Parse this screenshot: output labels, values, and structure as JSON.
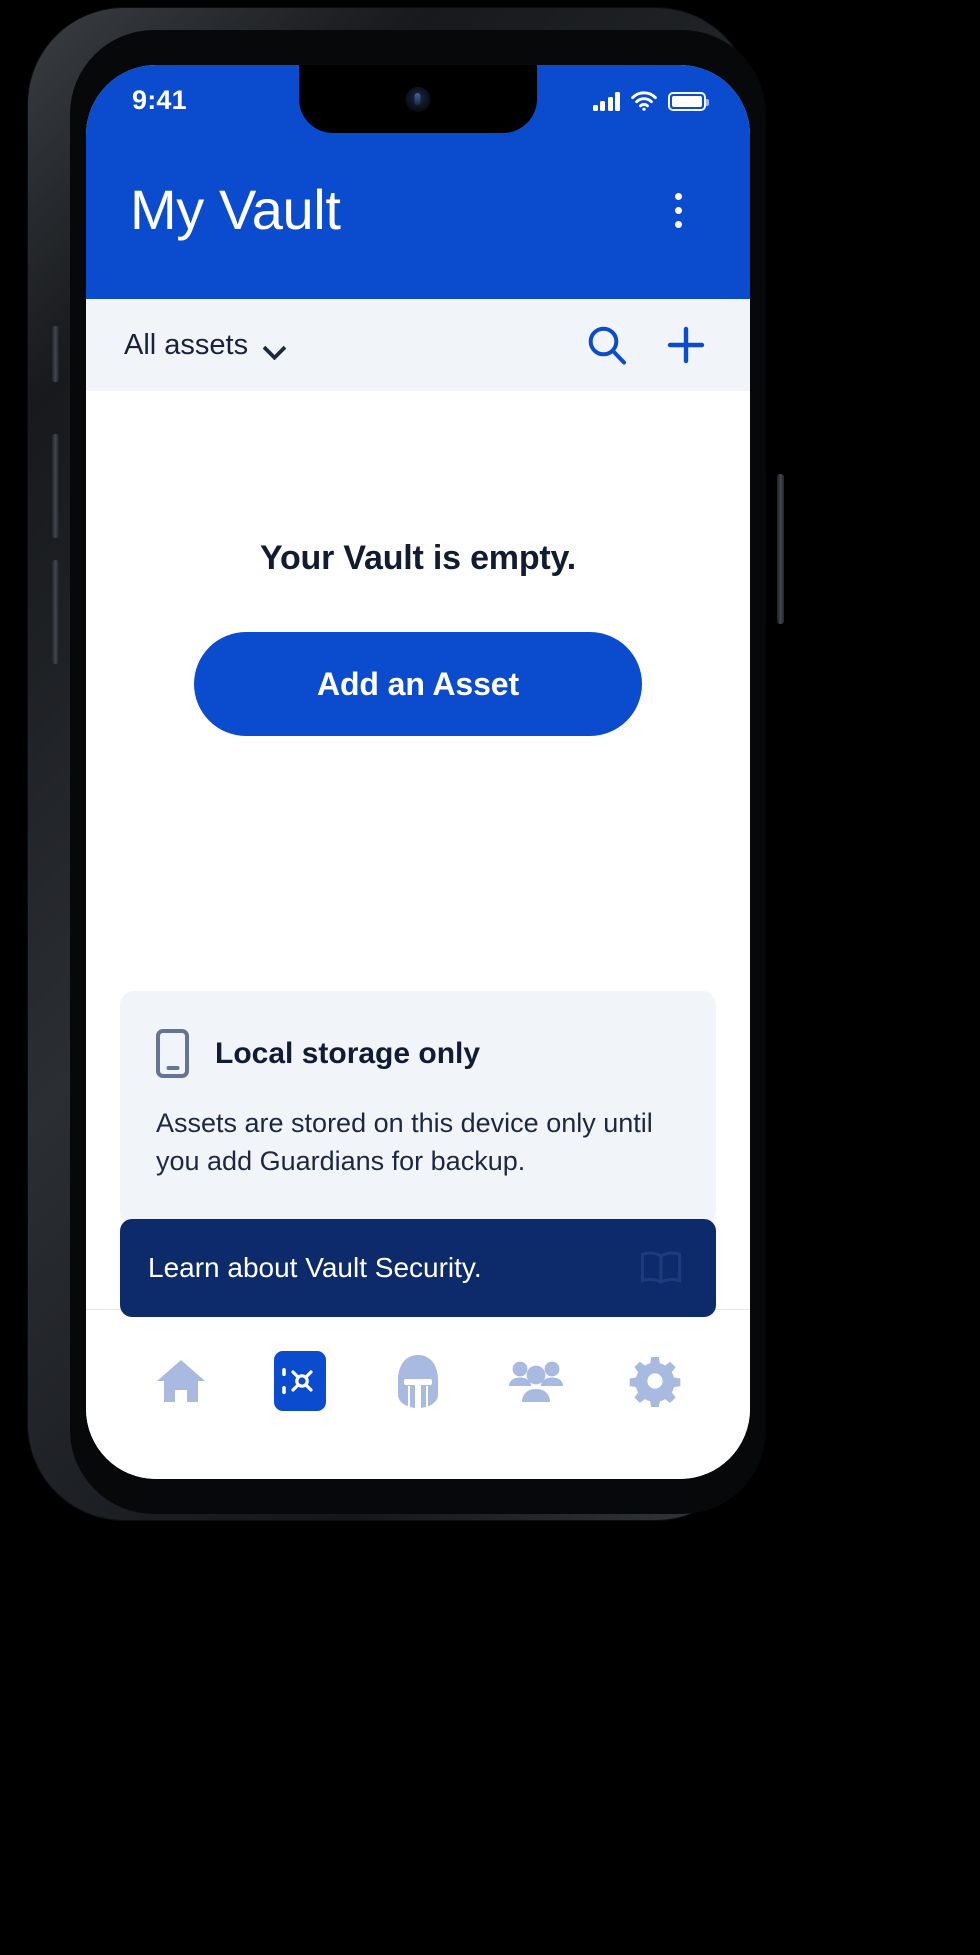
{
  "status_bar": {
    "time": "9:41",
    "signal_icon": "cellular-signal-icon",
    "wifi_icon": "wifi-icon",
    "battery_icon": "battery-full-icon"
  },
  "app_bar": {
    "title": "My Vault",
    "overflow_icon": "more-vertical-icon"
  },
  "filter_bar": {
    "selected_filter": "All assets",
    "chevron_icon": "chevron-down-icon",
    "search_icon": "search-icon",
    "add_icon": "plus-icon"
  },
  "empty_state": {
    "title": "Your Vault is empty.",
    "primary_button": "Add an Asset"
  },
  "info_card": {
    "icon": "mobile-phone-icon",
    "title": "Local storage only",
    "body": "Assets are stored on this device only until you add Guardians for backup."
  },
  "learn_banner": {
    "text": "Learn about Vault Security.",
    "icon": "open-book-icon"
  },
  "tab_bar": {
    "items": [
      {
        "name": "home",
        "icon": "home-icon",
        "active": false
      },
      {
        "name": "vault",
        "icon": "vault-safe-icon",
        "active": true
      },
      {
        "name": "guardian",
        "icon": "helmet-icon",
        "active": false
      },
      {
        "name": "people",
        "icon": "people-group-icon",
        "active": false
      },
      {
        "name": "settings",
        "icon": "gear-icon",
        "active": false
      }
    ]
  },
  "colors": {
    "brand_blue": "#0B4BCE",
    "navy_dark": "#0D2B6B",
    "surface_gray": "#F1F4F8",
    "text_dark": "#111C33",
    "icon_inactive": "#A8BADF"
  }
}
